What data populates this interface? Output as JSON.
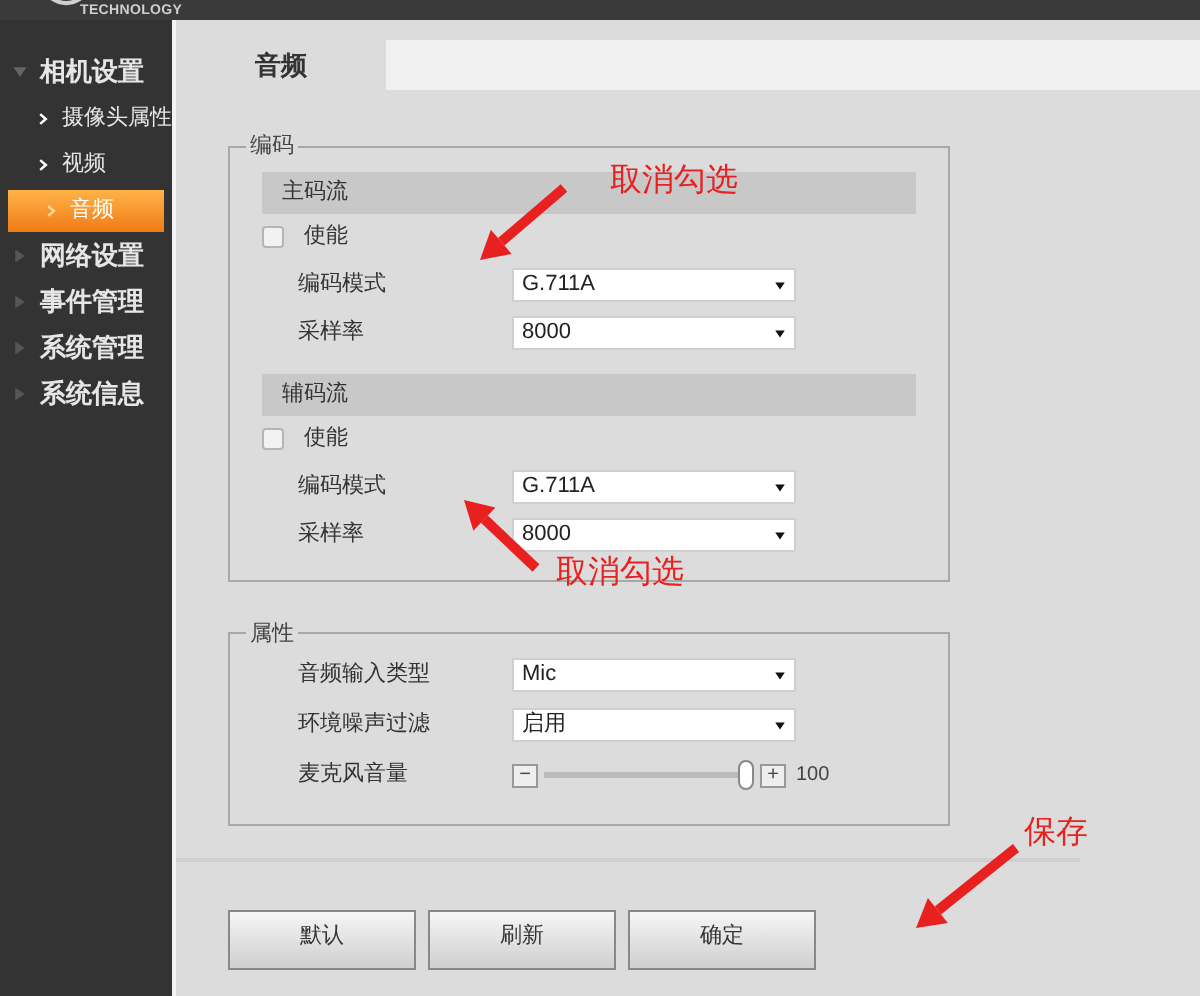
{
  "header": {
    "logo_text": "TECHNOLOGY"
  },
  "sidebar": {
    "items": [
      {
        "label": "相机设置",
        "expanded": true,
        "children": [
          {
            "label": "摄像头属性",
            "selected": false
          },
          {
            "label": "视频",
            "selected": false
          },
          {
            "label": "音频",
            "selected": true
          }
        ]
      },
      {
        "label": "网络设置",
        "expanded": false
      },
      {
        "label": "事件管理",
        "expanded": false
      },
      {
        "label": "系统管理",
        "expanded": false
      },
      {
        "label": "系统信息",
        "expanded": false
      }
    ]
  },
  "tabs": [
    {
      "label": "音频",
      "selected": true
    }
  ],
  "encoding": {
    "legend": "编码",
    "streams": [
      {
        "title": "主码流",
        "enable": {
          "label": "使能",
          "checked": false
        },
        "fields": [
          {
            "label": "编码模式",
            "value": "G.711A"
          },
          {
            "label": "采样率",
            "value": "8000"
          }
        ]
      },
      {
        "title": "辅码流",
        "enable": {
          "label": "使能",
          "checked": false
        },
        "fields": [
          {
            "label": "编码模式",
            "value": "G.711A"
          },
          {
            "label": "采样率",
            "value": "8000"
          }
        ]
      }
    ]
  },
  "properties": {
    "legend": "属性",
    "rows": [
      {
        "kind": "select",
        "label": "音频输入类型",
        "value": "Mic"
      },
      {
        "kind": "select",
        "label": "环境噪声过滤",
        "value": "启用"
      },
      {
        "kind": "slider",
        "label": "麦克风音量",
        "minus": "−",
        "plus": "+",
        "level": 1.0,
        "reading": "100"
      }
    ]
  },
  "buttons": [
    "默认",
    "刷新",
    "确定"
  ],
  "annotations": [
    {
      "text": "取消勾选"
    },
    {
      "text": "取消勾选"
    },
    {
      "text": "保存"
    }
  ]
}
